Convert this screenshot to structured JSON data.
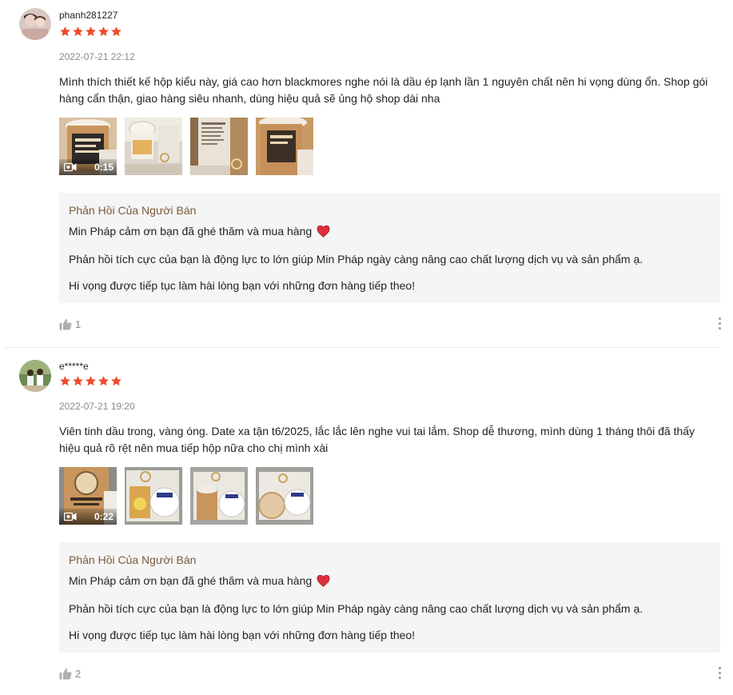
{
  "reviews": [
    {
      "username": "phanh281227",
      "rating": 5,
      "date": "2022-07-21 22:12",
      "comment": "Mình thích thiết kế hộp kiểu này, giá cao hơn blackmores nghe nói là dầu ép lạnh lần 1 nguyên chất nên hi vọng dùng ổn. Shop gói hàng cẩn thận, giao hàng siêu nhanh, dùng hiệu quả sẽ ủng hộ shop dài nha",
      "video_duration": "0:15",
      "seller_reply": {
        "title": "Phản Hồi Của Người Bán",
        "line1": "Min Pháp cảm ơn bạn đã ghé thăm và mua hàng",
        "line2": "Phản hồi tích cực của bạn là động lực to lớn giúp Min Pháp ngày càng nâng cao chất lượng dịch vụ và sản phẩm ạ.",
        "line3": "Hi vọng được tiếp tục làm hài lòng bạn với những đơn hàng tiếp theo!"
      },
      "likes": "1"
    },
    {
      "username": "e*****e",
      "rating": 5,
      "date": "2022-07-21 19:20",
      "comment": "Viên tinh dầu trong, vàng óng. Date xa tận t6/2025, lắc lắc lên nghe vui tai lắm. Shop dễ thương, mình dùng 1 tháng thôi đã thấy hiệu quả rõ rệt nên mua tiếp hộp nữa cho chị mình xài",
      "video_duration": "0:22",
      "seller_reply": {
        "title": "Phản Hồi Của Người Bán",
        "line1": "Min Pháp cảm ơn bạn đã ghé thăm và mua hàng",
        "line2": "Phản hồi tích cực của bạn là động lực to lớn giúp Min Pháp ngày càng nâng cao chất lượng dịch vụ và sản phẩm ạ.",
        "line3": "Hi vọng được tiếp tục làm hài lòng bạn với những đơn hàng tiếp theo!"
      },
      "likes": "2"
    }
  ],
  "colors": {
    "star": "#ee4d2d",
    "seller_title": "#7a5a3a",
    "heart": "#e02e3c"
  },
  "icons": {
    "star": "star-icon",
    "video": "camera-icon",
    "heart": "heart-icon",
    "like": "thumbs-up-icon",
    "more": "more-vertical-icon"
  }
}
